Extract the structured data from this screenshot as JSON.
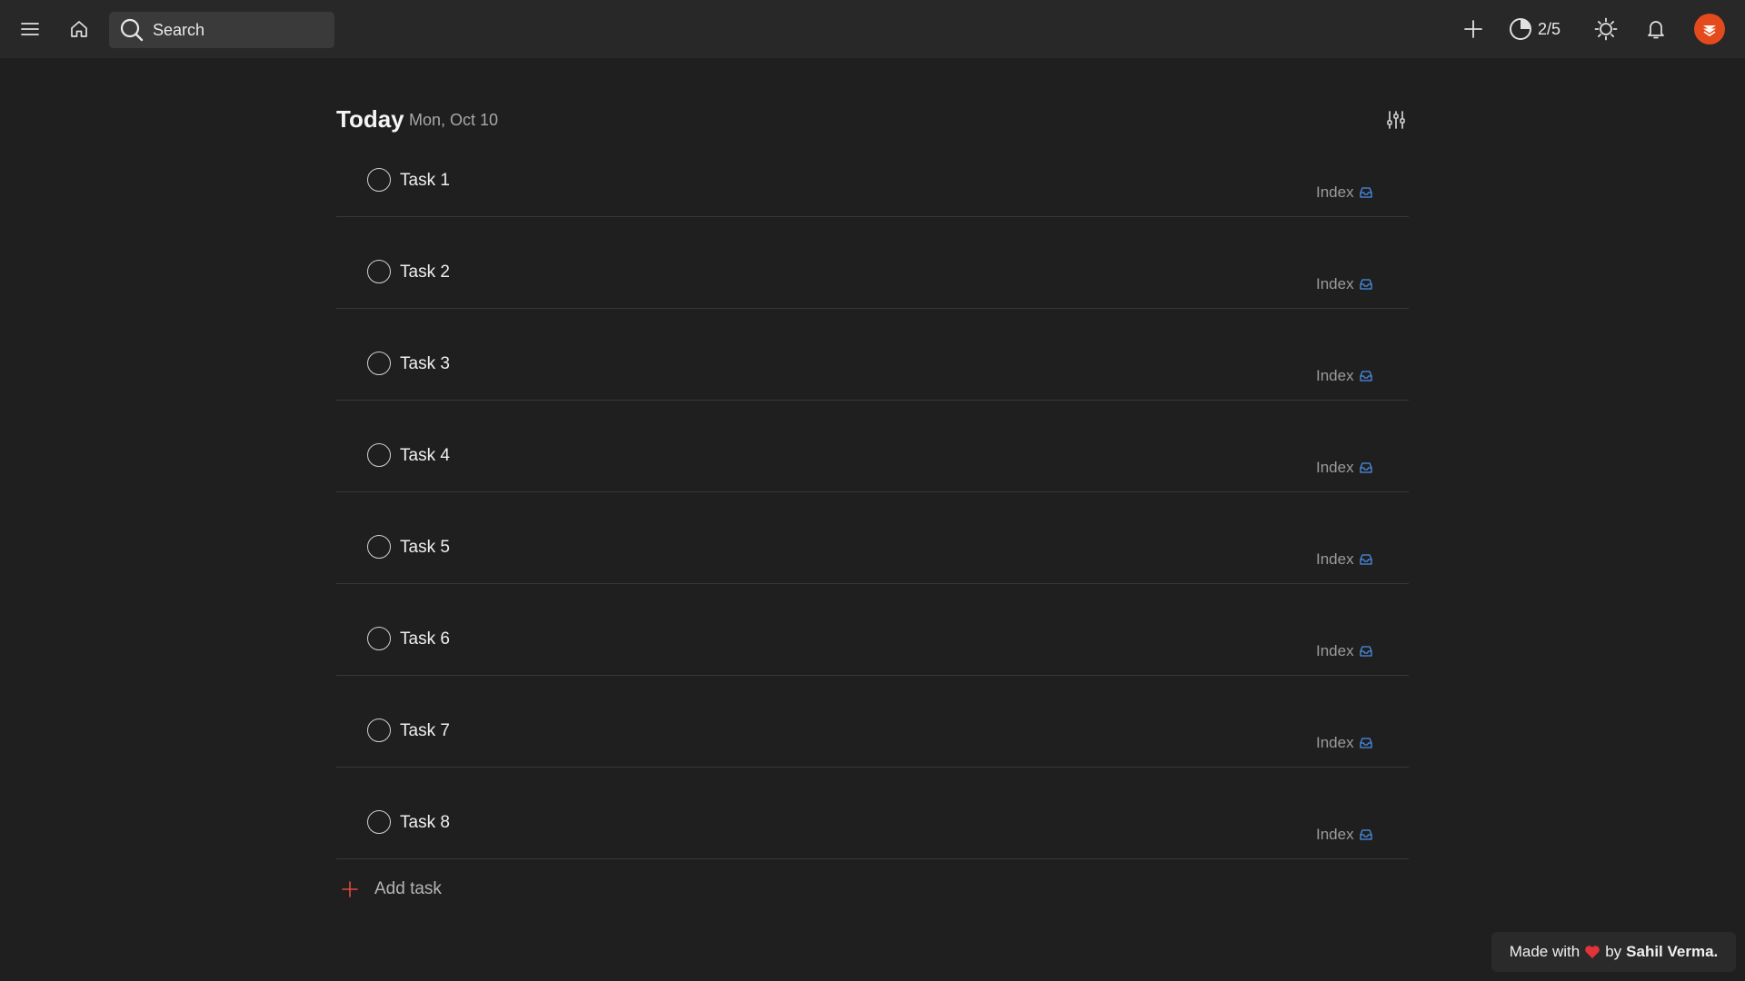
{
  "topbar": {
    "search_placeholder": "Search",
    "karma_progress": "2/5",
    "avatar_color": "#e44a1c"
  },
  "view": {
    "title": "Today",
    "date": "Mon, Oct 10"
  },
  "tasks": [
    {
      "title": "Task 1",
      "project": "Index"
    },
    {
      "title": "Task 2",
      "project": "Index"
    },
    {
      "title": "Task 3",
      "project": "Index"
    },
    {
      "title": "Task 4",
      "project": "Index"
    },
    {
      "title": "Task 5",
      "project": "Index"
    },
    {
      "title": "Task 6",
      "project": "Index"
    },
    {
      "title": "Task 7",
      "project": "Index"
    },
    {
      "title": "Task 8",
      "project": "Index"
    }
  ],
  "add_task_label": "Add task",
  "colors": {
    "accent_red": "#dc4c3e",
    "inbox_icon": "#4a8fe7",
    "heart": "#e0343a"
  },
  "footer": {
    "made_with": "Made with",
    "by": "by",
    "author": "Sahil Verma."
  }
}
